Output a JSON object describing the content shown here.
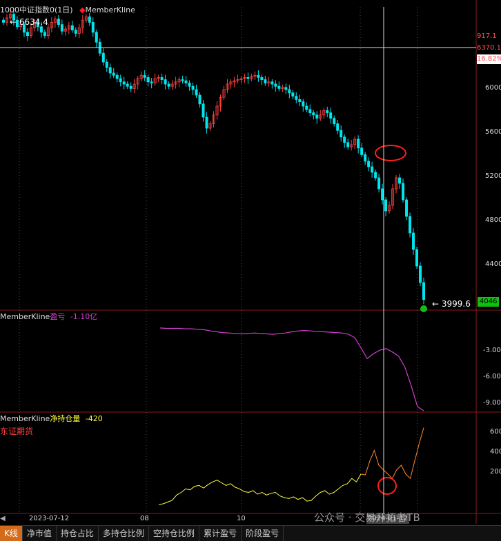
{
  "panel1": {
    "title": "1000中证指数0(1日)",
    "marker": "◆",
    "series_label": "MemberKline",
    "high_label": "6634.4",
    "low_label": "3999.6",
    "right_top": [
      "917.1",
      "6370.1",
      "16.82%"
    ],
    "yticks": [
      "6000",
      "5600",
      "5200",
      "4800",
      "4400"
    ],
    "last_box": "4046"
  },
  "panel2": {
    "series": "MemberKline",
    "name": "盈亏",
    "value": "-1.10亿",
    "yticks": [
      "-3.000",
      "-6.000",
      "-9.000"
    ]
  },
  "panel3": {
    "series": "MemberKline",
    "name": "净持仓量",
    "value": "-420",
    "member": "东证期货",
    "yticks": [
      "600",
      "400",
      "200"
    ]
  },
  "xaxis": {
    "labels": [
      "2023-07-12",
      "08",
      "10",
      "2024-01-12"
    ]
  },
  "tabs": [
    "K线",
    "净市值",
    "持仓占比",
    "多持仓比例",
    "空持仓比例",
    "累计盈亏",
    "阶段盈亏"
  ],
  "watermark": "公众号 · 交易开拓者TB",
  "colors": {
    "up": "#ff4040",
    "down": "#00e5ee",
    "pnl": "#d040d0",
    "net": "#ffff40",
    "net_recent": "#ff8c30",
    "grid": "#8b1a1a",
    "highlight": "#ff2020"
  },
  "chart_data": [
    {
      "type": "candlestick",
      "title": "1000中证指数0(1日)",
      "xlabel": "",
      "ylabel": "",
      "ylim": [
        3950,
        6700
      ],
      "x_tick_labels": [
        "2023-07-12",
        "08",
        "10",
        "2024-01-12"
      ],
      "close": [
        6560,
        6600,
        6634,
        6580,
        6520,
        6540,
        6470,
        6440,
        6510,
        6560,
        6520,
        6470,
        6440,
        6510,
        6560,
        6590,
        6540,
        6480,
        6500,
        6530,
        6490,
        6460,
        6510,
        6580,
        6610,
        6560,
        6470,
        6380,
        6280,
        6200,
        6150,
        6100,
        6080,
        6050,
        6020,
        6000,
        5980,
        5960,
        6000,
        6050,
        6080,
        6060,
        6020,
        6010,
        6050,
        6060,
        6040,
        6000,
        5980,
        6000,
        6020,
        6040,
        6030,
        6010,
        5980,
        5950,
        5900,
        5820,
        5700,
        5600,
        5640,
        5720,
        5800,
        5880,
        5950,
        6000,
        6020,
        6030,
        6040,
        6050,
        6060,
        6050,
        6070,
        6080,
        6060,
        6040,
        6010,
        6020,
        6000,
        5980,
        5960,
        5970,
        5950,
        5920,
        5890,
        5860,
        5840,
        5800,
        5770,
        5740,
        5720,
        5690,
        5720,
        5760,
        5740,
        5690,
        5640,
        5580,
        5520,
        5470,
        5430,
        5450,
        5500,
        5420,
        5360,
        5300,
        5250,
        5200,
        5150,
        5050,
        4950,
        4850,
        4900,
        5050,
        5150,
        5100,
        4950,
        4800,
        4650,
        4500,
        4350,
        4200,
        4046
      ],
      "marker_high": 6634.4,
      "marker_low": 3999.6
    },
    {
      "type": "line",
      "name": "盈亏",
      "unit": "亿",
      "ylim": [
        -10,
        0.5
      ],
      "values": [
        -0.15,
        -0.2,
        -0.2,
        -0.2,
        -0.25,
        -0.25,
        -0.3,
        -0.35,
        -0.5,
        -0.6,
        -0.7,
        -0.75,
        -0.8,
        -0.85,
        -0.8,
        -0.75,
        -0.8,
        -0.85,
        -0.9,
        -0.8,
        -0.75,
        -0.6,
        -0.5,
        -0.45,
        -0.5,
        -0.55,
        -0.6,
        -0.65,
        -0.7,
        -0.75,
        -0.9,
        -1.3,
        -2.5,
        -3.8,
        -3.2,
        -2.8,
        -2.6,
        -3.0,
        -3.5,
        -4.8,
        -7.0,
        -9.5,
        -10.0
      ]
    },
    {
      "type": "line",
      "name": "净持仓量",
      "member": "东证期货",
      "ylim": [
        -300,
        700
      ],
      "values": [
        -200,
        -190,
        -170,
        -150,
        -90,
        -60,
        -20,
        -30,
        10,
        20,
        -10,
        30,
        60,
        80,
        50,
        20,
        40,
        0,
        -20,
        -50,
        -60,
        -40,
        -80,
        -60,
        -90,
        -70,
        -60,
        -100,
        -120,
        -130,
        -110,
        -140,
        -120,
        -160,
        -150,
        -100,
        -60,
        -40,
        -80,
        -60,
        -20,
        20,
        40,
        100,
        60,
        150,
        140,
        300,
        420,
        250,
        200,
        150,
        100,
        200,
        250,
        150,
        100,
        300,
        500,
        680
      ]
    }
  ]
}
